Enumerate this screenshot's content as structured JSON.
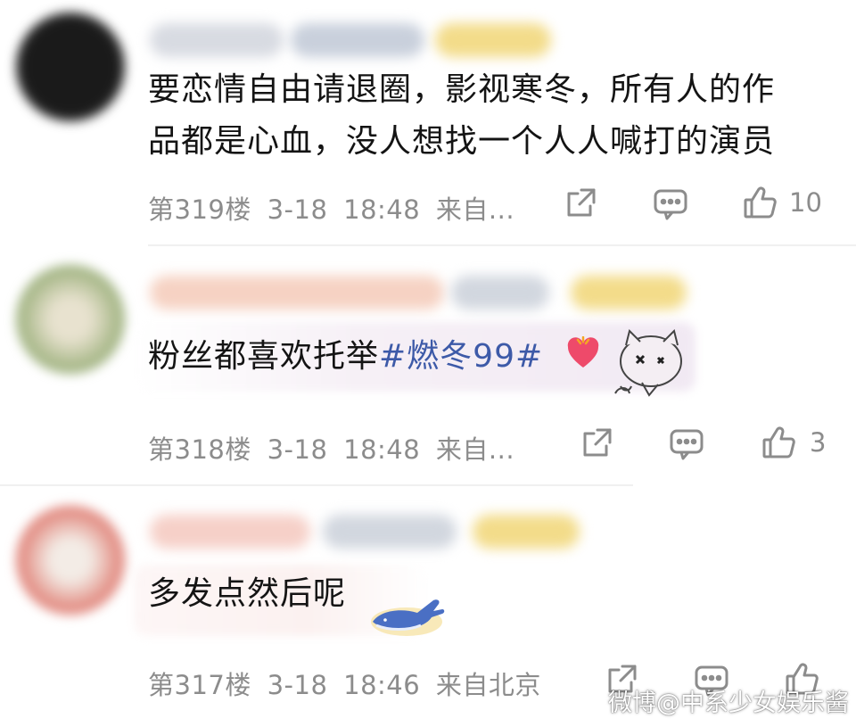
{
  "comments": [
    {
      "text_line1": "要恋情自由请退圈，影视寒冬，所有人的作",
      "text_line2": "品都是心血，没人想找一个人人喊打的演员",
      "floor": "第319楼",
      "date": "3-18",
      "time": "18:48",
      "source": "来自...",
      "likes": "10",
      "avatar_color": "#141414"
    },
    {
      "text_plain": "粉丝都喜欢托举",
      "hashtag": "#燃冬99#",
      "floor": "第318楼",
      "date": "3-18",
      "time": "18:48",
      "source": "来自...",
      "likes": "3",
      "avatar_color": "#8aa36a"
    },
    {
      "text": "多发点然后呢",
      "floor": "第317楼",
      "date": "3-18",
      "time": "18:46",
      "source": "来自北京",
      "likes": "",
      "avatar_color": "#d9776b"
    }
  ],
  "icons": {
    "share": "share-icon",
    "comment": "comment-icon",
    "like": "like-icon"
  },
  "watermark": "微博@中系少女娱乐酱"
}
